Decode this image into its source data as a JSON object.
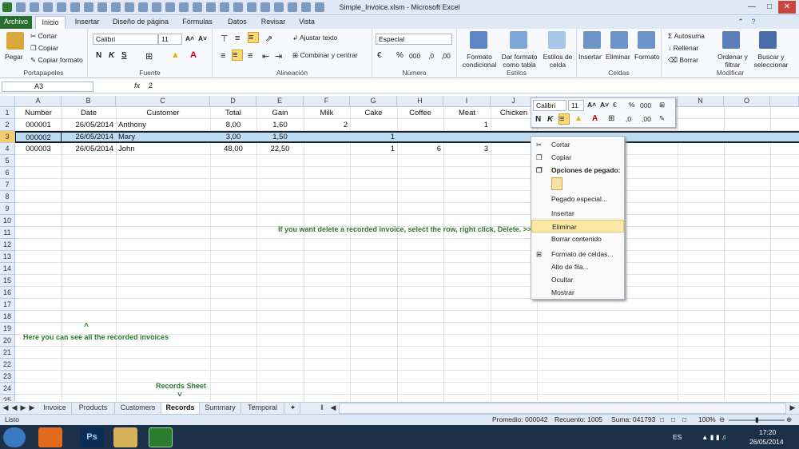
{
  "window": {
    "title": "Simple_Invoice.xlsm - Microsoft Excel"
  },
  "tabs": [
    "Archivo",
    "Inicio",
    "Insertar",
    "Diseño de página",
    "Fórmulas",
    "Datos",
    "Revisar",
    "Vista"
  ],
  "ribbon": {
    "clipboard": {
      "paste": "Pegar",
      "cut": "Cortar",
      "copy": "Copiar",
      "format_painter": "Copiar formato",
      "label": "Portapapeles"
    },
    "font": {
      "name": "Calibri",
      "size": "11",
      "bold": "N",
      "italic": "K",
      "underline": "S",
      "label": "Fuente"
    },
    "alignment": {
      "wrap": "Ajustar texto",
      "merge": "Combinar y centrar",
      "label": "Alineación"
    },
    "number": {
      "format": "Especial",
      "label": "Número"
    },
    "styles": {
      "cond": "Formato condicional",
      "table": "Dar formato como tabla",
      "cell": "Estilos de celda",
      "label": "Estilos"
    },
    "cells": {
      "insert": "Insertar",
      "delete": "Eliminar",
      "format": "Formato",
      "label": "Celdas"
    },
    "editing": {
      "autosum": "Autosuma",
      "fill": "Rellenar",
      "clear": "Borrar",
      "sort": "Ordenar y filtrar",
      "find": "Buscar y seleccionar",
      "label": "Modificar"
    }
  },
  "formula_bar": {
    "cell_ref": "A3",
    "fx": "fx",
    "value": "2"
  },
  "columns": [
    "A",
    "B",
    "C",
    "D",
    "E",
    "F",
    "G",
    "H",
    "I",
    "J",
    "N",
    "O"
  ],
  "rows": [
    "1",
    "2",
    "3",
    "4",
    "5",
    "6",
    "7",
    "8",
    "9",
    "10",
    "11",
    "12",
    "13",
    "14",
    "15",
    "16",
    "17",
    "18",
    "19",
    "20",
    "21",
    "22",
    "23",
    "24",
    "25"
  ],
  "headers": [
    "Number",
    "Date",
    "Customer",
    "Total",
    "Gain",
    "Milk",
    "Cake",
    "Coffee",
    "Meat",
    "Chicken"
  ],
  "records": [
    {
      "number": "000001",
      "date": "26/05/2014",
      "customer": "Anthony",
      "total": "8,00",
      "gain": "1,60",
      "milk": "2",
      "cake": "",
      "coffee": "",
      "meat": "1"
    },
    {
      "number": "000002",
      "date": "26/05/2014",
      "customer": "Mary",
      "total": "3,00",
      "gain": "1,50",
      "milk": "",
      "cake": "1",
      "coffee": "",
      "meat": ""
    },
    {
      "number": "000003",
      "date": "26/05/2014",
      "customer": "John",
      "total": "48,00",
      "gain": "22,50",
      "milk": "",
      "cake": "1",
      "coffee": "6",
      "meat": "3"
    }
  ],
  "notes": {
    "delete": "If you want delete a recorded invoice, select the row, right click, Delete. >>",
    "records": "Here you can see all the recorded invoices",
    "sheet": "Records Sheet"
  },
  "minibar": {
    "font": "Calibri",
    "size": "11"
  },
  "context_menu": [
    "Cortar",
    "Copiar",
    "Opciones de pegado:",
    "Pegado especial...",
    "Insertar",
    "Eliminar",
    "Borrar contenido",
    "Formato de celdas...",
    "Alto de fila...",
    "Ocultar",
    "Mostrar"
  ],
  "sheets": [
    "Invoice",
    "Products",
    "Customers",
    "Records",
    "Summary",
    "Temporal"
  ],
  "status": {
    "mode": "Listo",
    "average": "Promedio: 000042",
    "count": "Recuento: 1005",
    "sum": "Suma: 041793",
    "zoom": "100%"
  },
  "taskbar": {
    "lang": "ES",
    "time": "17:20",
    "date": "26/05/2014"
  },
  "colors": {
    "selection": "#bcdcf3",
    "note_green": "#2b7a2b",
    "file_tab": "#2a6e2e"
  }
}
